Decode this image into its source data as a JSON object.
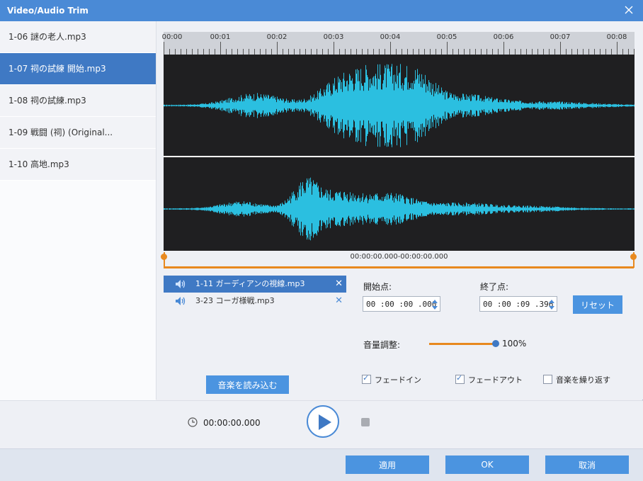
{
  "window": {
    "title": "Video/Audio Trim"
  },
  "sidebar": {
    "items": [
      {
        "label": "1-06 謎の老人.mp3",
        "active": false
      },
      {
        "label": "1-07 祠の試練 開始.mp3",
        "active": true
      },
      {
        "label": "1-08 祠の試練.mp3",
        "active": false
      },
      {
        "label": "1-09 戦闘 (祠) (Original...",
        "active": false
      },
      {
        "label": "1-10 高地.mp3",
        "active": false
      }
    ]
  },
  "timeline": {
    "ticks": [
      "00:00",
      "00:01",
      "00:02",
      "00:03",
      "00:04",
      "00:05",
      "00:06",
      "00:07",
      "00:08"
    ],
    "range_label": "00:00:00.000-00:00:00.000"
  },
  "waveform": {
    "color": "#2bbfe0",
    "background": "#1f1f21"
  },
  "music": {
    "items": [
      {
        "name": "1-11 ガーディアンの視線.mp3",
        "active": true
      },
      {
        "name": "3-23 コーガ様戦.mp3",
        "active": false
      }
    ],
    "load_button": "音楽を読み込む"
  },
  "trim": {
    "start_label": "開始点:",
    "start_value": "00 :00 :00 .000",
    "end_label": "終了点:",
    "end_value": "00 :00 :09 .396",
    "reset_button": "リセット"
  },
  "volume": {
    "label": "音量調整:",
    "value_text": "100%",
    "level": 1.0
  },
  "options": {
    "fade_in": {
      "label": "フェードイン",
      "checked": true
    },
    "fade_out": {
      "label": "フェードアウト",
      "checked": true
    },
    "loop": {
      "label": "音楽を繰り返す",
      "checked": false
    }
  },
  "player": {
    "current_time": "00:00:00.000"
  },
  "footer": {
    "apply": "適用",
    "ok": "OK",
    "cancel": "取消"
  },
  "colors": {
    "accent": "#4a8ad6",
    "orange": "#e8891f",
    "wave": "#2bbfe0"
  }
}
